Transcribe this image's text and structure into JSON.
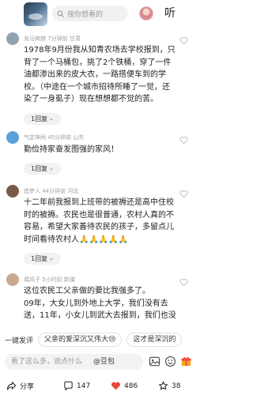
{
  "header": {
    "search_placeholder": "搜你想看的",
    "listen_label": "听"
  },
  "comments": [
    {
      "meta": "龙马爽朗  7分钟前  甘肃",
      "lines": [
        "1978年9月份我从知青农场去学校报到，只",
        "背了一个马桶包，挑了2个铁桶，穿了一件",
        "油都渗出来的皮大衣，一路搭便车到的学",
        "校。（中途在一个城市招待所睡了一觉，还",
        "染了一身虱子）现在想想都不觉的苦。"
      ],
      "reply_label": "1回复",
      "avatar_color": "#8fa3b0"
    },
    {
      "meta": "气定神闲  45分钟前  山东",
      "lines": [
        "勤俭持家奋发图强的家风！"
      ],
      "reply_label": "1回复",
      "avatar_color": "#5aa0d8"
    },
    {
      "meta": "追梦人  44分钟前  河北",
      "lines": [
        "十二年前我报到上班带的被褥还是高中住校",
        "时的被褥。农民也是很普通，农村人真的不",
        "容易，希望大家善待农民的孩子，多留点儿",
        "时间看待农村人🙏🙏🙏🙏🙏"
      ],
      "reply_label": "1回复",
      "avatar_color": "#7a5a4a"
    },
    {
      "meta": "偶风子  5小时前  新疆",
      "lines": [
        "这位农民工父亲做的要比我强多了。",
        "09年，大女儿到外地上大学，我们没有去",
        "送，11年，小女儿到武大去报到，我们也没"
      ],
      "avatar_color": "#c8a890"
    }
  ],
  "quick_replies": {
    "plain": "一键发评",
    "chips": [
      "父亲的爱深沉又伟大😢",
      "这才是深沉的"
    ]
  },
  "input": {
    "placeholder": "看了这么多，说点什么",
    "mention": "@豆包"
  },
  "actions": {
    "share_label": "分享",
    "comments_count": "147",
    "likes_count": "486",
    "favorites_count": "38"
  },
  "colors": {
    "accent": "#e5352b",
    "like_red": "#e8443a"
  }
}
